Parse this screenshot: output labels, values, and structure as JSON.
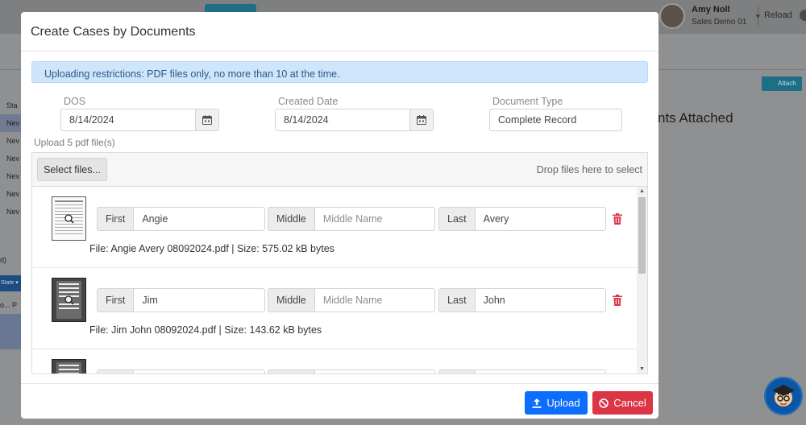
{
  "background": {
    "user": {
      "name": "Amy Noll",
      "role": "Sales Demo 01"
    },
    "reload_label": "Reload",
    "attach_label": "Attach",
    "heading": "nts Attached",
    "sidebar_items": [
      "Sta",
      "Nev",
      "Nev",
      "Nev",
      "Nev",
      "Nev",
      "Nev"
    ],
    "state_label": "State",
    "small_text_1": "d)",
    "small_text_2": "o... P"
  },
  "modal": {
    "title": "Create Cases by Documents",
    "alert": "Uploading restrictions: PDF files only, no more than 10 at the time.",
    "fields": {
      "dos": {
        "label": "DOS",
        "value": "8/14/2024"
      },
      "created_date": {
        "label": "Created Date",
        "value": "8/14/2024"
      },
      "document_type": {
        "label": "Document Type",
        "value": "Complete Record"
      }
    },
    "upload_hint": "Upload 5 pdf file(s)",
    "select_files_label": "Select files...",
    "drop_text": "Drop files here to select",
    "files": [
      {
        "first": "Angie",
        "middle": "",
        "last": "Avery",
        "info": "File: Angie Avery 08092024.pdf | Size: 575.02 kB bytes"
      },
      {
        "first": "Jim",
        "middle": "",
        "last": "John",
        "info": "File: Jim John 08092024.pdf | Size: 143.62 kB bytes"
      },
      {
        "first": "",
        "middle": "",
        "last": "",
        "info": ""
      }
    ],
    "name_labels": {
      "first": "First",
      "middle": "Middle",
      "last": "Last",
      "middle_placeholder": "Middle Name"
    },
    "footer": {
      "upload_label": "Upload",
      "cancel_label": "Cancel"
    }
  },
  "colors": {
    "primary": "#0d6efd",
    "danger": "#dc3545",
    "alert_bg": "#cfe5fb"
  }
}
